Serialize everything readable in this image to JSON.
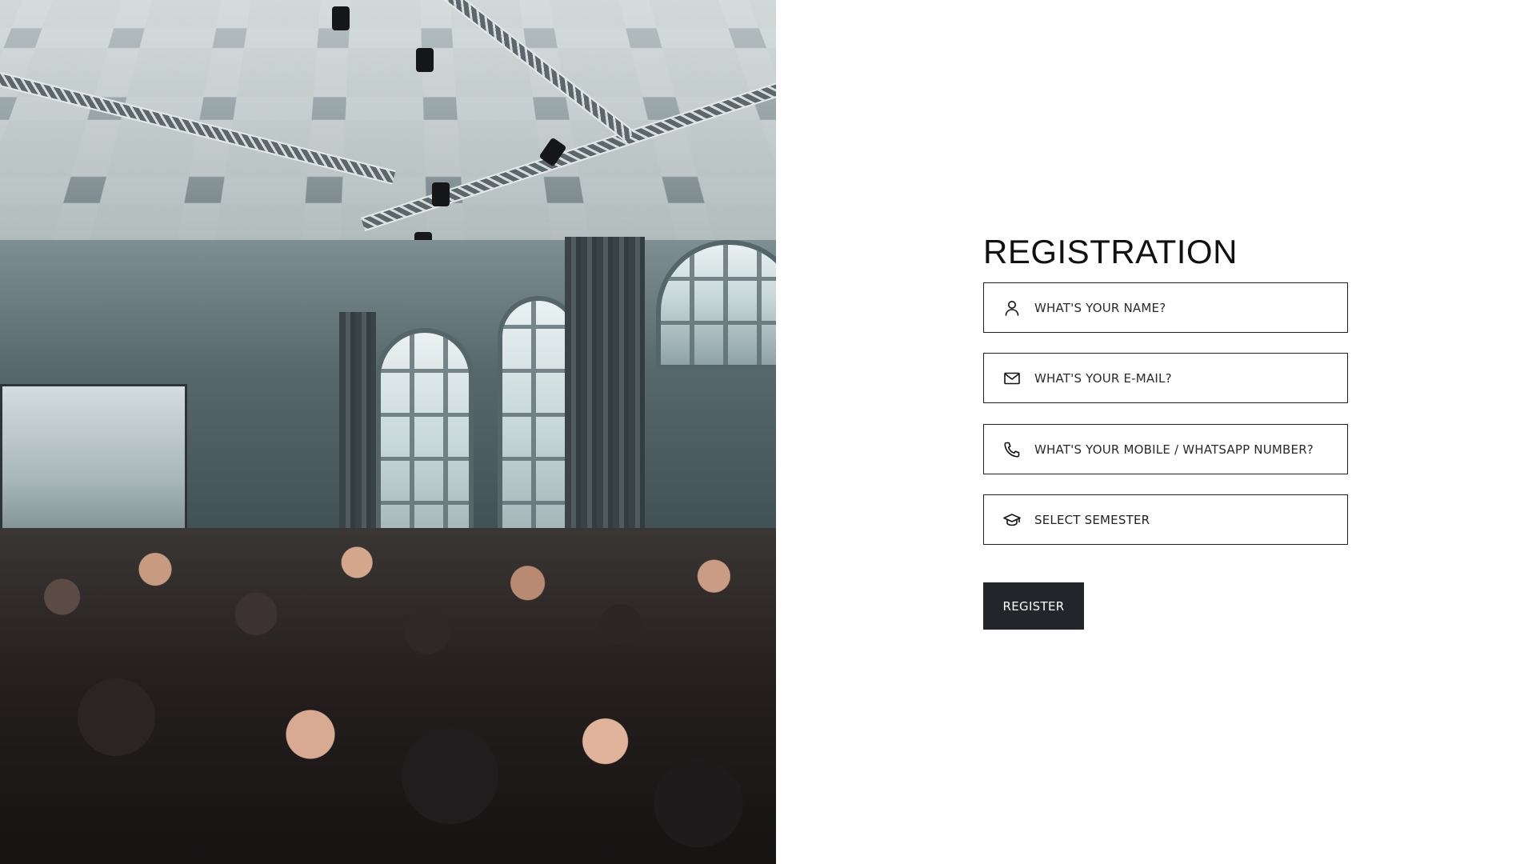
{
  "hero": {
    "image_description_icon": "event-hall-photo"
  },
  "form": {
    "title": "REGISTRATION",
    "fields": [
      {
        "icon": "user-icon",
        "placeholder": "WHAT'S YOUR NAME?",
        "value": ""
      },
      {
        "icon": "envelope-icon",
        "placeholder": "WHAT'S YOUR E-MAIL?",
        "value": ""
      },
      {
        "icon": "phone-icon",
        "placeholder": "WHAT'S YOUR MOBILE / WHATSAPP NUMBER?",
        "value": ""
      },
      {
        "icon": "graduation-cap-icon",
        "placeholder": "SELECT SEMESTER",
        "selected": "SELECT SEMESTER"
      }
    ],
    "submit_label": "REGISTER"
  },
  "colors": {
    "button_bg": "#22252a",
    "button_text": "#ffffff",
    "field_border": "#1f1f1f",
    "page_bg": "#ffffff"
  }
}
